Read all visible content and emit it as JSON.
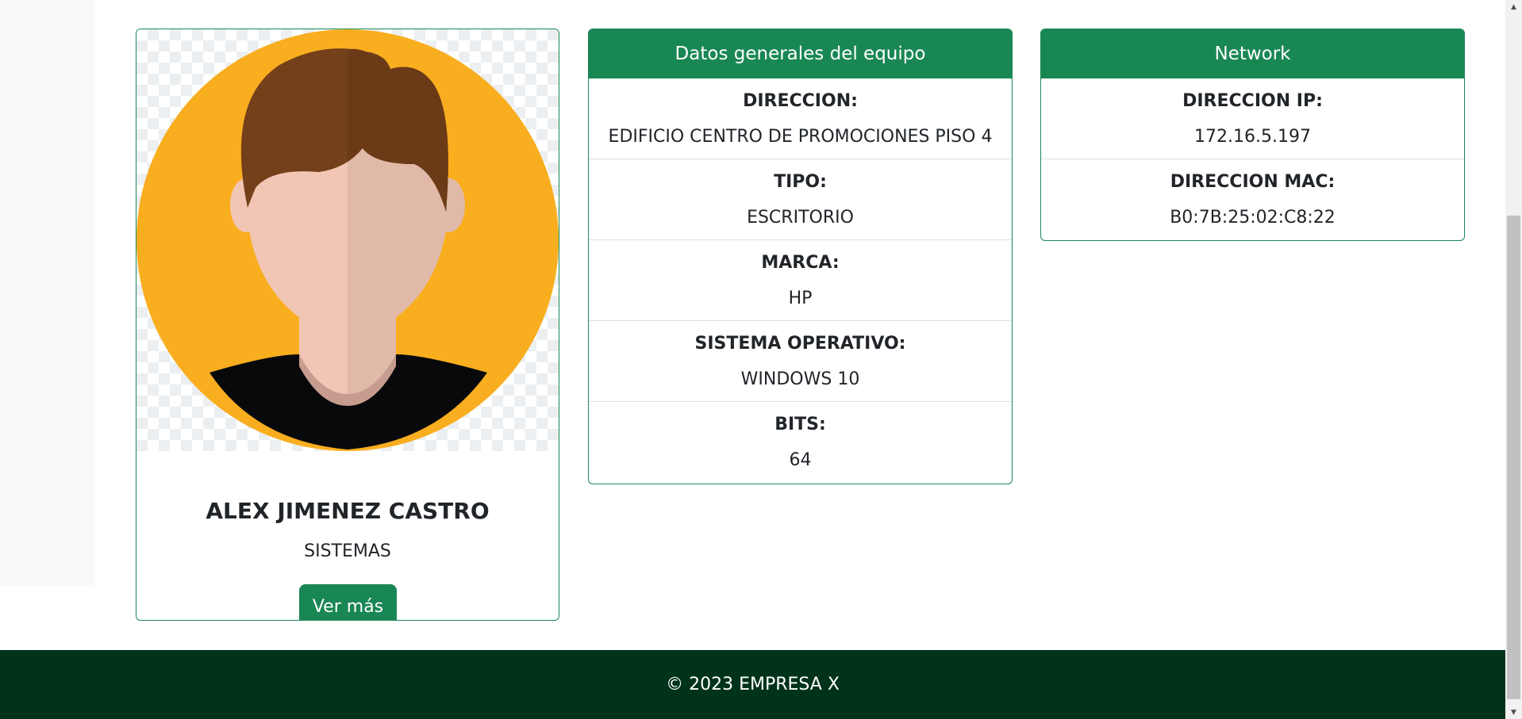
{
  "profile": {
    "name": "ALEX JIMENEZ CASTRO",
    "department": "SISTEMAS",
    "button_label": "Ver más"
  },
  "general": {
    "header": "Datos generales del equipo",
    "fields": [
      {
        "label": "DIRECCION:",
        "value": "EDIFICIO CENTRO DE PROMOCIONES PISO 4"
      },
      {
        "label": "TIPO:",
        "value": "ESCRITORIO"
      },
      {
        "label": "MARCA:",
        "value": "HP"
      },
      {
        "label": "SISTEMA OPERATIVO:",
        "value": "WINDOWS 10"
      },
      {
        "label": "BITS:",
        "value": "64"
      }
    ]
  },
  "network": {
    "header": "Network",
    "fields": [
      {
        "label": "DIRECCION IP:",
        "value": "172.16.5.197"
      },
      {
        "label": "DIRECCION MAC:",
        "value": "B0:7B:25:02:C8:22"
      }
    ]
  },
  "footer": {
    "text": "© 2023 EMPRESA X"
  },
  "colors": {
    "accent": "#198754",
    "footer_bg": "#00331a",
    "avatar_bg": "#f9ae1f"
  },
  "icons": {
    "avatar": "user-avatar-illustration",
    "scroll_up": "scroll-up-arrow-icon",
    "scroll_down": "scroll-down-arrow-icon"
  }
}
